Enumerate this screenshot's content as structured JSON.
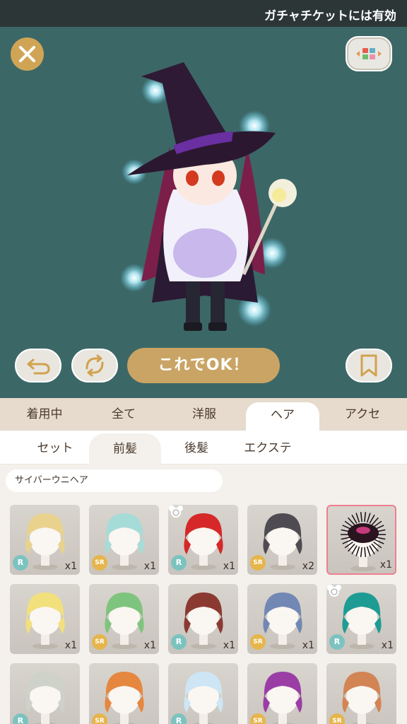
{
  "ticker": {
    "text": "ガチャチケットには有効"
  },
  "stage": {
    "ok_label": "これでOK！",
    "icons": [
      "close-icon",
      "view-toggle-icon",
      "undo-icon",
      "refresh-icon",
      "bookmark-icon"
    ]
  },
  "tabs": [
    {
      "label": "着用中",
      "active": false
    },
    {
      "label": "全て",
      "active": false
    },
    {
      "label": "洋服",
      "active": false
    },
    {
      "label": "ヘア",
      "active": true
    },
    {
      "label": "アクセ",
      "active": false
    }
  ],
  "subtabs": [
    {
      "label": "セット",
      "selected": false
    },
    {
      "label": "前髪",
      "selected": true
    },
    {
      "label": "後髪",
      "selected": false
    },
    {
      "label": "エクステ",
      "selected": false
    }
  ],
  "current_item": {
    "name": "サイバーウニヘア"
  },
  "items": [
    {
      "rarity": "R",
      "count": "x1",
      "hair_color": "#e8d28e",
      "bear": false,
      "selected": false
    },
    {
      "rarity": "SR",
      "count": "x1",
      "hair_color": "#a6dcd8",
      "bear": false,
      "selected": false
    },
    {
      "rarity": "R",
      "count": "x1",
      "hair_color": "#d62828",
      "bear": true,
      "selected": false
    },
    {
      "rarity": "SR",
      "count": "x2",
      "hair_color": "#4f4b52",
      "bear": false,
      "selected": false
    },
    {
      "rarity": "",
      "count": "x1",
      "hair_color": "#2a1420",
      "bear": false,
      "selected": true
    },
    {
      "rarity": "",
      "count": "x1",
      "hair_color": "#f1e07c",
      "bear": false,
      "selected": false
    },
    {
      "rarity": "SR",
      "count": "x1",
      "hair_color": "#7fc47e",
      "bear": false,
      "selected": false
    },
    {
      "rarity": "R",
      "count": "x1",
      "hair_color": "#8b3a32",
      "bear": false,
      "selected": false
    },
    {
      "rarity": "SR",
      "count": "x1",
      "hair_color": "#7288b4",
      "bear": false,
      "selected": false
    },
    {
      "rarity": "R",
      "count": "x1",
      "hair_color": "#1e9c94",
      "bear": true,
      "selected": false
    },
    {
      "rarity": "R",
      "count": "",
      "hair_color": "#cfd2c9",
      "bear": false,
      "selected": false
    },
    {
      "rarity": "SR",
      "count": "",
      "hair_color": "#e68740",
      "bear": false,
      "selected": false
    },
    {
      "rarity": "R",
      "count": "",
      "hair_color": "#cde5f4",
      "bear": false,
      "selected": false
    },
    {
      "rarity": "SR",
      "count": "",
      "hair_color": "#9a3ea6",
      "bear": false,
      "selected": false
    },
    {
      "rarity": "SR",
      "count": "",
      "hair_color": "#d38455",
      "bear": false,
      "selected": false
    }
  ],
  "colors": {
    "stage_bg": "#3c6767",
    "gold": "#c9a464",
    "rarity_r": "#7cc3c0",
    "rarity_sr": "#e6b54b",
    "selected_border": "#ee7f90"
  }
}
